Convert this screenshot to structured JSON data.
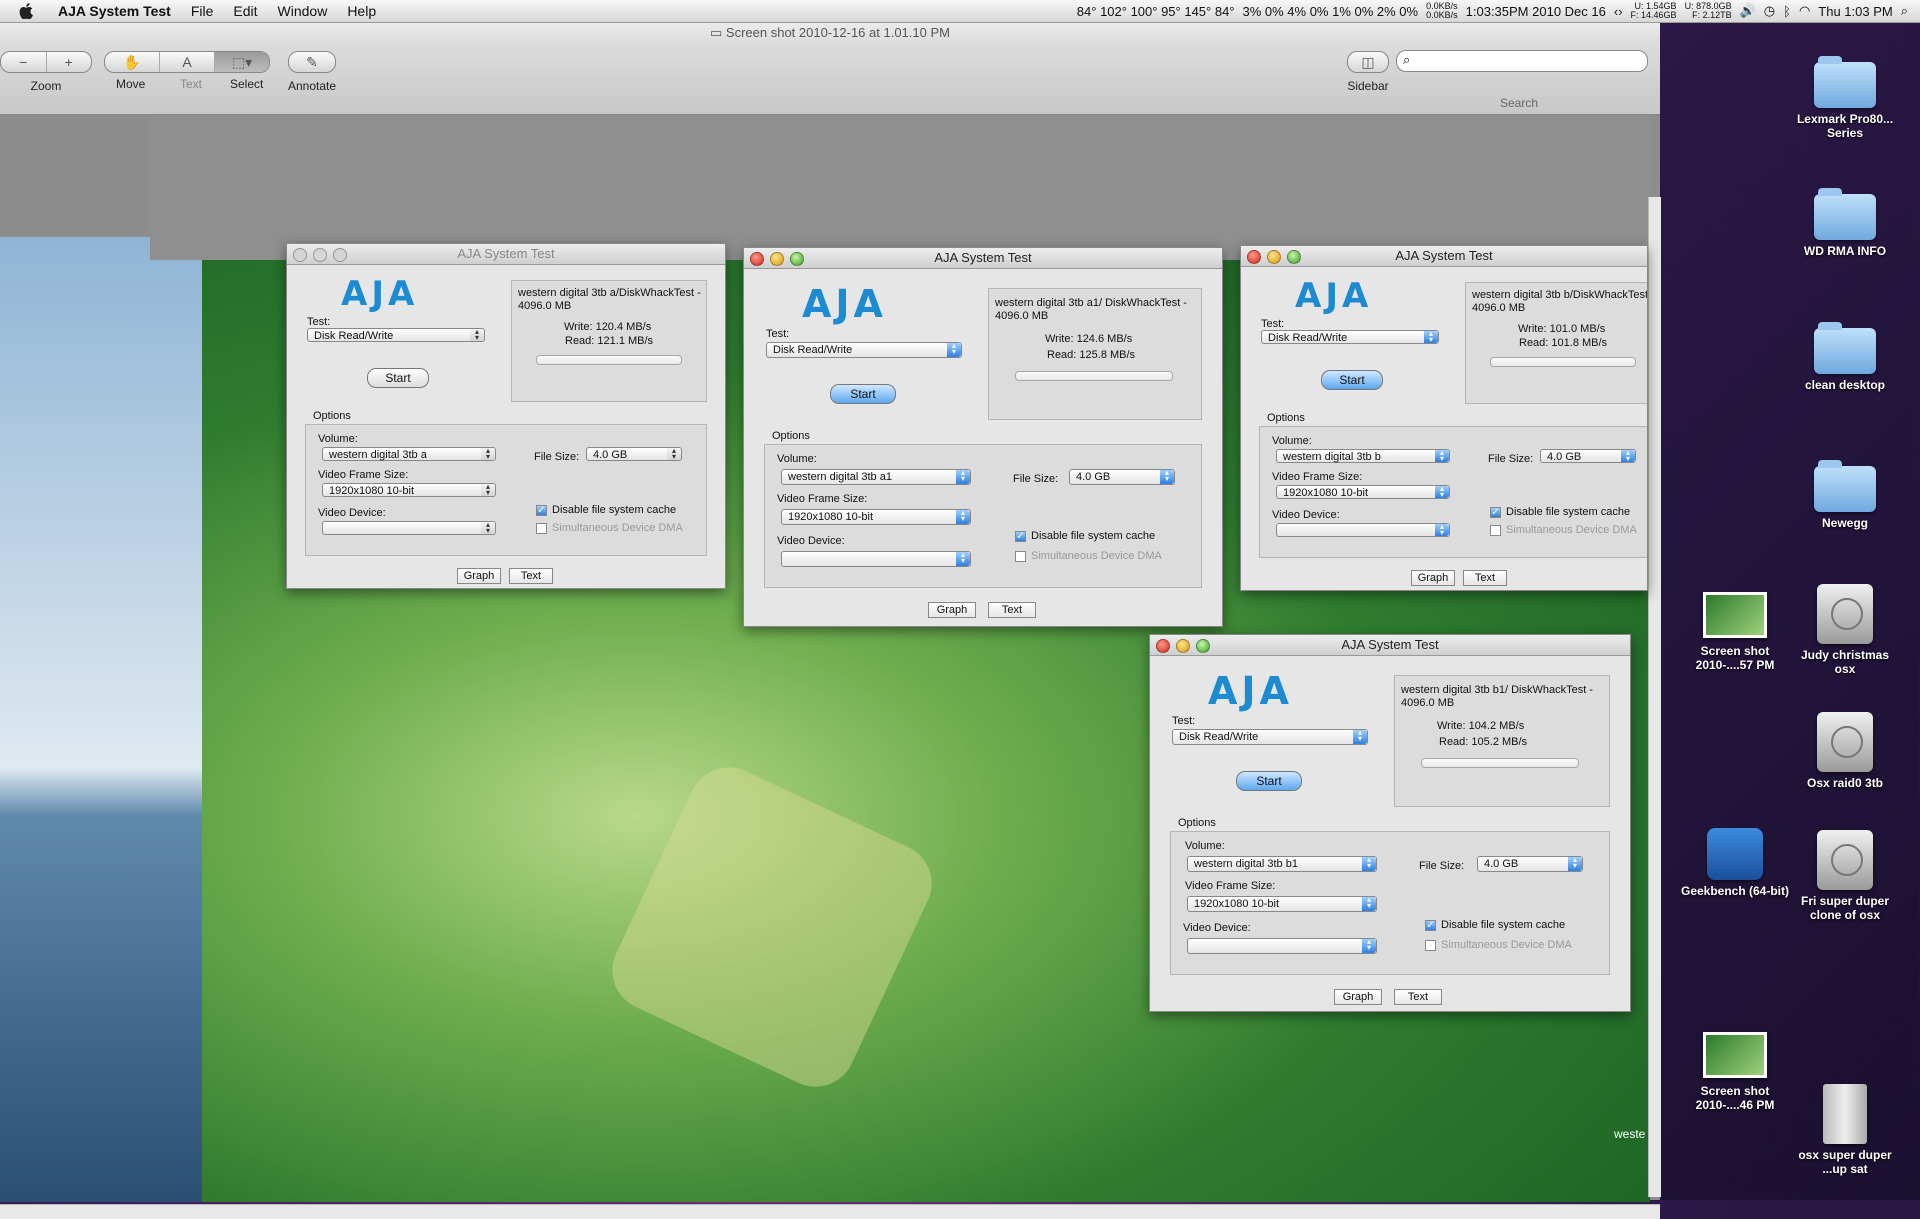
{
  "menubar": {
    "app": "AJA System Test",
    "items": [
      "File",
      "Edit",
      "Window",
      "Help"
    ],
    "status_temps": "84° 102° 100° 95° 145° 84°",
    "status_cpu": "3%  0%  4%  0%  1%  0%  2%  0%",
    "net_top": "0.0KB/s",
    "net_bottom": "0.0KB/s",
    "clock_detail": "1:03:35PM 2010 Dec 16",
    "disk_u1": "U: 1.54GB",
    "disk_f1": "F: 14.46GB",
    "disk_u2": "U: 878.0GB",
    "disk_f2": "F: 2.12TB",
    "clock": "Thu 1:03 PM"
  },
  "preview": {
    "title": "Screen shot 2010-12-16 at 1.01.10 PM",
    "tools": [
      "Zoom",
      "Move",
      "Text",
      "Select",
      "Annotate"
    ],
    "sidebar": "Sidebar",
    "search_label": "Search"
  },
  "aja_common": {
    "title": "AJA System Test",
    "logo": "AJA",
    "test_label": "Test:",
    "test_value": "Disk Read/Write",
    "start": "Start",
    "options": "Options",
    "volume_label": "Volume:",
    "frame_label": "Video Frame Size:",
    "frame_value": "1920x1080 10-bit",
    "device_label": "Video Device:",
    "filesize_label": "File Size:",
    "filesize_value": "4.0 GB",
    "cache_label": "Disable file system cache",
    "dma_label": "Simultaneous Device DMA",
    "graph": "Graph",
    "text": "Text"
  },
  "windows": [
    {
      "path": "western digital 3tb a/DiskWhackTest - 4096.0 MB",
      "write": "Write: 120.4 MB/s",
      "read": "Read: 121.1 MB/s",
      "volume": "western digital 3tb a"
    },
    {
      "path": "western digital 3tb a1/ DiskWhackTest - 4096.0 MB",
      "write": "Write: 124.6 MB/s",
      "read": "Read: 125.8 MB/s",
      "volume": "western digital 3tb a1"
    },
    {
      "path": "western digital 3tb b/DiskWhackTest - 4096.0 MB",
      "write": "Write: 101.0 MB/s",
      "read": "Read: 101.8 MB/s",
      "volume": "western digital 3tb b"
    },
    {
      "path": "western digital 3tb b1/ DiskWhackTest - 4096.0 MB",
      "write": "Write: 104.2 MB/s",
      "read": "Read: 105.2 MB/s",
      "volume": "western digital 3tb b1"
    }
  ],
  "desktop": [
    "Lexmark Pro80... Series",
    "WD RMA INFO",
    "clean desktop",
    "Newegg",
    "Screen shot 2010-....57 PM",
    "Judy christmas osx",
    "Osx raid0 3tb",
    "Geekbench (64-bit)",
    "Fri super duper clone of osx",
    "Screen shot 2010-....46 PM",
    "osx super duper ...up sat"
  ],
  "fragment": "weste"
}
